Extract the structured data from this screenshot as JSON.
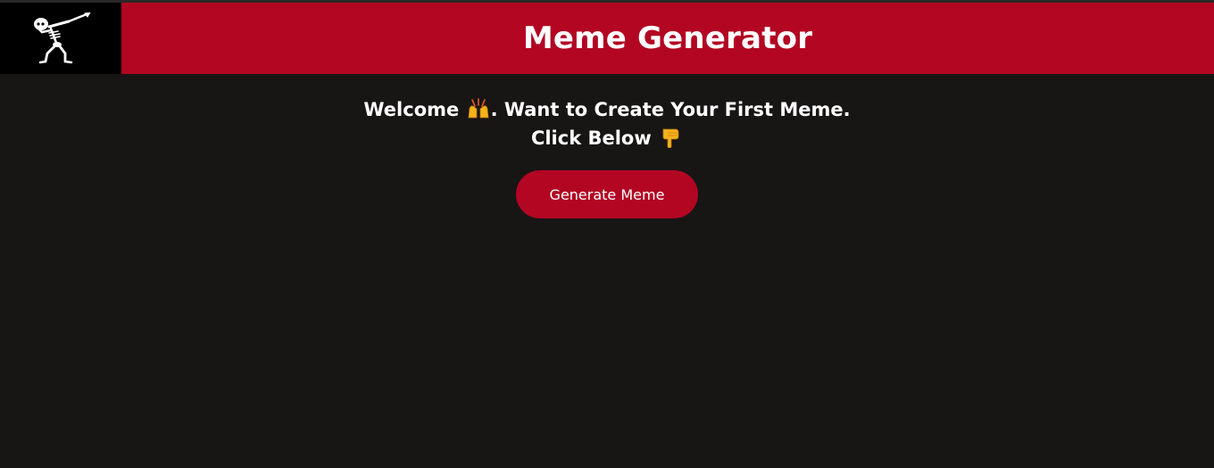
{
  "header": {
    "title": "Meme Generator",
    "logo_icon": "dabbing-skeleton-icon"
  },
  "main": {
    "welcome_part1": "Welcome ",
    "welcome_part2": ". Want to Create Your First Meme.",
    "welcome_emoji_1": "raising-hands-icon",
    "click_text": "Click Below ",
    "welcome_emoji_2": "pointing-down-icon",
    "button_label": "Generate Meme"
  },
  "colors": {
    "background": "#181515",
    "brand_red": "#b20623",
    "logo_bg": "#000000",
    "text": "#ffffff",
    "emoji_yellow": "#f6b21c"
  }
}
